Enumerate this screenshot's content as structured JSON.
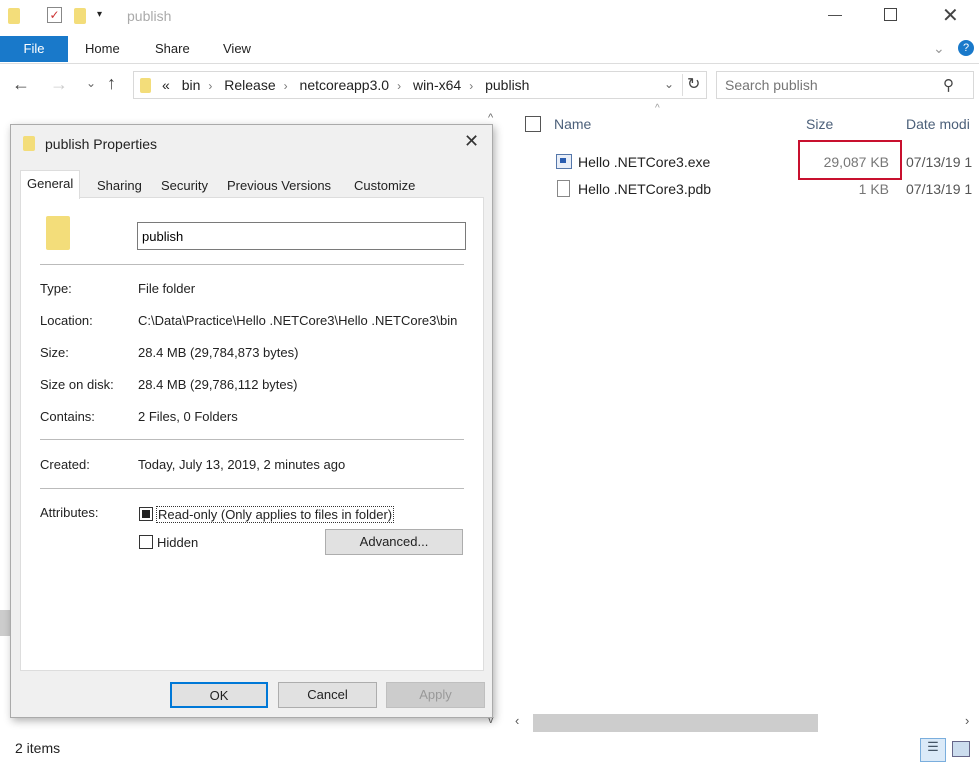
{
  "window": {
    "title": "publish"
  },
  "ribbon": {
    "tabs": [
      "File",
      "Home",
      "Share",
      "View"
    ]
  },
  "address": {
    "overflow": "«",
    "crumbs": [
      "bin",
      "Release",
      "netcoreapp3.0",
      "win-x64",
      "publish"
    ]
  },
  "search": {
    "placeholder": "Search publish"
  },
  "columns": {
    "name": "Name",
    "size": "Size",
    "date": "Date modi"
  },
  "files": [
    {
      "name": "Hello .NETCore3.exe",
      "size": "29,087 KB",
      "date": "07/13/19 1",
      "icon": "exe-icon"
    },
    {
      "name": "Hello .NETCore3.pdb",
      "size": "1 KB",
      "date": "07/13/19 1",
      "icon": "file-icon"
    }
  ],
  "highlight_color": "#c8102e",
  "status": {
    "items": "2 items"
  },
  "dialog": {
    "title": "publish Properties",
    "tabs": [
      "General",
      "Sharing",
      "Security",
      "Previous Versions",
      "Customize"
    ],
    "name": "publish",
    "props": [
      {
        "label": "Type:",
        "value": "File folder"
      },
      {
        "label": "Location:",
        "value": "C:\\Data\\Practice\\Hello .NETCore3\\Hello .NETCore3\\bin"
      },
      {
        "label": "Size:",
        "value": "28.4 MB (29,784,873 bytes)"
      },
      {
        "label": "Size on disk:",
        "value": "28.4 MB (29,786,112 bytes)"
      },
      {
        "label": "Contains:",
        "value": "2 Files, 0 Folders"
      }
    ],
    "created": {
      "label": "Created:",
      "value": "Today, July 13, 2019, 2 minutes ago"
    },
    "attributes": {
      "label": "Attributes:",
      "readonly": "Read-only (Only applies to files in folder)",
      "hidden": "Hidden",
      "advanced": "Advanced..."
    },
    "buttons": {
      "ok": "OK",
      "cancel": "Cancel",
      "apply": "Apply"
    }
  }
}
